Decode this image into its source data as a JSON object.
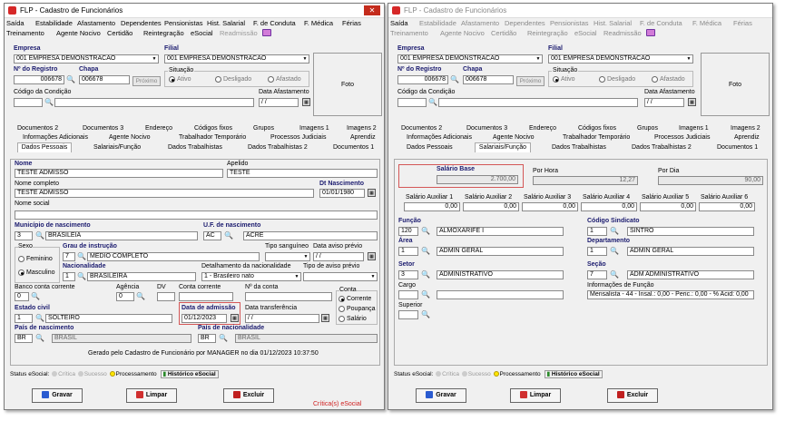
{
  "left": {
    "title": "FLP - Cadastro de Funcionários",
    "menu1": [
      "Saída",
      "Estabilidade",
      "Afastamento",
      "Dependentes",
      "Pensionistas",
      "Hist. Salarial",
      "F. de Conduta",
      "F. Médica",
      "Férias"
    ],
    "menu2": [
      "Treinamento",
      "Agente Nocivo",
      "Certidão",
      "Reintegração",
      "eSocial",
      "Readmissão"
    ],
    "empresa_label": "Empresa",
    "empresa": "001 EMPRESA DEMONSTRACAO",
    "filial_label": "Filial",
    "filial": "001 EMPRESA DEMONSTRACAO",
    "registro_label": "Nº do Registro",
    "registro": "006678",
    "chapa_label": "Chapa",
    "chapa": "006678",
    "proximo": "Próximo",
    "situacao_label": "Situação",
    "ativo": "Ativo",
    "desligado": "Desligado",
    "afastado": "Afastado",
    "cod_condicao_label": "Código da Condição",
    "data_afast_label": "Data Afastamento",
    "data_afast": "/ /",
    "foto": "Foto",
    "tabs_row1": [
      "Documentos 2",
      "Documentos 3",
      "Endereço",
      "Códigos fixos",
      "Grupos",
      "Imagens 1",
      "Imagens 2"
    ],
    "tabs_row2": [
      "Informações Adicionais",
      "Agente Nocivo",
      "Trabalhador Temporário",
      "Processos Judiciais",
      "Aprendiz"
    ],
    "tabs_row3": [
      "Dados Pessoais",
      "Salariais/Função",
      "Dados Trabalhistas",
      "Dados Trabalhistas 2",
      "Documentos 1"
    ],
    "nome_label": "Nome",
    "nome": "TESTE ADMISSO",
    "apelido_label": "Apelido",
    "apelido": "TESTE",
    "nome_completo_label": "Nome completo",
    "nome_completo": "TESTE ADMISSO",
    "dt_nasc_label": "Dt Nascimento",
    "dt_nasc": "01/01/1980",
    "nome_social_label": "Nome social",
    "municipio_label": "Município de nascimento",
    "municipio_cod": "3",
    "municipio": "BRASILEIA",
    "uf_label": "U.F. de nascimento",
    "uf": "AC",
    "uf_nome": "ACRE",
    "sexo_label": "Sexo",
    "feminino": "Feminino",
    "masculino": "Masculino",
    "grau_label": "Grau de instrução",
    "grau_cod": "7",
    "grau": "MÉDIO COMPLETO",
    "tipo_sang_label": "Tipo sanguíneo",
    "data_aviso_label": "Data aviso prévio",
    "data_aviso": "/ /",
    "nac_label": "Nacionalidade",
    "nac_cod": "1",
    "nac": "BRASILEIRA",
    "det_nac_label": "Detalhamento da nacionalidade",
    "det_nac": "1 - Brasileiro nato",
    "tipo_aviso_label": "Tipo de aviso prévio",
    "banco_label": "Banco conta corrente",
    "banco": "0",
    "agencia_label": "Agência",
    "agencia": "0",
    "dv_label": "DV",
    "conta_label": "Conta corrente",
    "nconta_label": "Nº da conta",
    "conta_group": "Conta",
    "corrente": "Corrente",
    "poupanca": "Poupança",
    "salario": "Salário",
    "estado_civil_label": "Estado civil",
    "estado_civil_cod": "1",
    "estado_civil": "SOLTEIRO",
    "admissao_label": "Data de admissão",
    "admissao": "01/12/2023",
    "transf_label": "Data transferência",
    "transf": "/ /",
    "pais_nasc_label": "País de nascimento",
    "pais_nasc_cod": "BR",
    "pais_nasc": "BRASIL",
    "pais_nac_label": "País de nacionalidade",
    "pais_nac_cod": "BR",
    "pais_nac": "BRASIL",
    "gerado": "Gerado pelo Cadastro de Funcionário por MANAGER no dia 01/12/2023 10:37:50",
    "critica_esocial": "Crítica(s) eSocial"
  },
  "right": {
    "title": "FLP - Cadastro de Funcionários",
    "tabs_row1": [
      "Documentos 2",
      "Documentos 3",
      "Endereço",
      "Códigos fixos",
      "Grupos",
      "Imagens 1",
      "Imagens 2"
    ],
    "tabs_row2": [
      "Informações Adicionais",
      "Agente Nocivo",
      "Trabalhador Temporário",
      "Processos Judiciais",
      "Aprendiz"
    ],
    "tabs_row3": [
      "Dados Pessoais",
      "Salariais/Função",
      "Dados Trabalhistas",
      "Dados Trabalhistas 2",
      "Documentos 1"
    ],
    "salario_base_label": "Salário Base",
    "salario_base": "2.700,00",
    "por_hora_label": "Por Hora",
    "por_hora": "12,27",
    "por_dia_label": "Por Dia",
    "por_dia": "90,00",
    "aux_labels": [
      "Salário Auxiliar 1",
      "Salário Auxiliar 2",
      "Salário Auxiliar 3",
      "Salário Auxiliar 4",
      "Salário Auxiliar 5",
      "Salário Auxiliar 6"
    ],
    "aux_values": [
      "0,00",
      "0,00",
      "0,00",
      "0,00",
      "0,00",
      "0,00"
    ],
    "funcao_label": "Função",
    "funcao_cod": "120",
    "funcao": "ALMOXARIFE I",
    "sindicato_label": "Código Sindicato",
    "sindicato_cod": "1",
    "sindicato": "SINTRO",
    "area_label": "Área",
    "area_cod": "1",
    "area": "ADMIN GERAL",
    "depto_label": "Departamento",
    "depto_cod": "1",
    "depto": "ADMIN GERAL",
    "setor_label": "Setor",
    "setor_cod": "3",
    "setor": "ADMINISTRATIVO",
    "secao_label": "Seção",
    "secao_cod": "7",
    "secao": "ADM ADMINISTRATIVO",
    "cargo_label": "Cargo",
    "info_funcao_label": "Informações de Função",
    "info_funcao": "Mensalista - 44 - Insal.: 0,00 - Peric.: 0,00 - % Acid: 0,00",
    "superior_label": "Superior"
  },
  "status": {
    "label": "Status eSocial:",
    "critica": "Crítica",
    "sucesso": "Sucesso",
    "processamento": "Processamento",
    "historico": "Histórico eSocial"
  },
  "buttons": {
    "gravar": "Gravar",
    "limpar": "Limpar",
    "excluir": "Excluir"
  }
}
